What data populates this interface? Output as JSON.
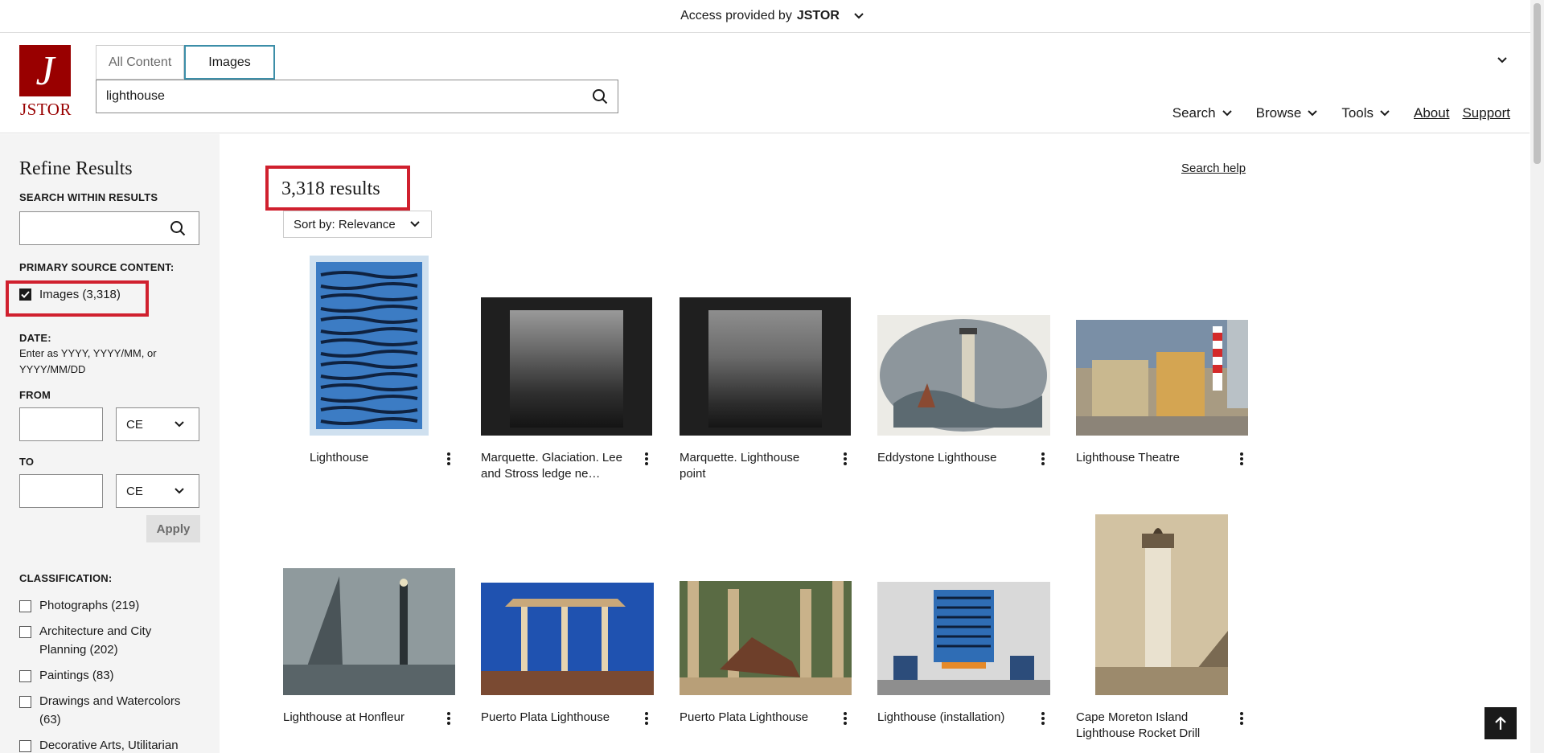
{
  "banner": {
    "prefix": "Access provided by",
    "brand": "JSTOR"
  },
  "logo": {
    "letter": "J",
    "text": "JSTOR"
  },
  "tabs": [
    {
      "label": "All Content"
    },
    {
      "label": "Images"
    }
  ],
  "search": {
    "value": "lighthouse"
  },
  "nav": {
    "search": "Search",
    "browse": "Browse",
    "tools": "Tools",
    "about": "About",
    "support": "Support"
  },
  "sidebar": {
    "title": "Refine Results",
    "search_within_label": "SEARCH WITHIN RESULTS",
    "primary_source_label": "PRIMARY SOURCE CONTENT:",
    "images_filter": "Images (3,318)",
    "date_label": "DATE:",
    "date_hint": "Enter as YYYY, YYYY/MM, or YYYY/MM/DD",
    "from_label": "FROM",
    "to_label": "TO",
    "era_from": "CE",
    "era_to": "CE",
    "apply": "Apply",
    "classification_label": "CLASSIFICATION:",
    "classifications": [
      "Photographs (219)",
      "Architecture and City Planning (202)",
      "Paintings (83)",
      "Drawings and Watercolors (63)",
      "Decorative Arts, Utilitarian"
    ]
  },
  "results": {
    "count": "3,318 results",
    "search_help": "Search help",
    "sort": "Sort by: Relevance",
    "items": [
      {
        "title": "Lighthouse"
      },
      {
        "title": "Marquette. Glaciation. Lee and Stross ledge ne…"
      },
      {
        "title": "Marquette. Lighthouse point"
      },
      {
        "title": "Eddystone Lighthouse"
      },
      {
        "title": "Lighthouse Theatre"
      },
      {
        "title": "Lighthouse at Honfleur"
      },
      {
        "title": "Puerto Plata Lighthouse"
      },
      {
        "title": "Puerto Plata Lighthouse"
      },
      {
        "title": "Lighthouse (installation)"
      },
      {
        "title": "Cape Moreton Island Lighthouse Rocket Drill"
      }
    ]
  }
}
